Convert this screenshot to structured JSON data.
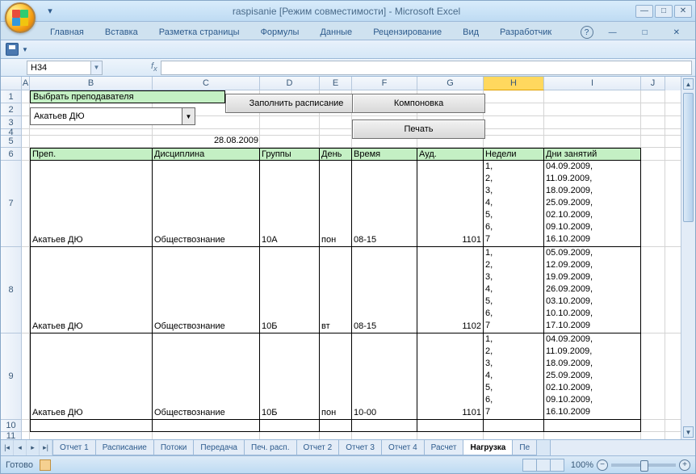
{
  "app": {
    "title": "raspisanie  [Режим совместимости] - Microsoft Excel"
  },
  "ribbon": {
    "tabs": [
      "Главная",
      "Вставка",
      "Разметка страницы",
      "Формулы",
      "Данные",
      "Рецензирование",
      "Вид",
      "Разработчик"
    ]
  },
  "namebox": "H34",
  "columns": {
    "A": 10,
    "B": 152,
    "C": 133,
    "D": 74,
    "E": 40,
    "F": 81,
    "G": 82,
    "H": 75,
    "I": 120,
    "J": 30
  },
  "row_heights": {
    "1": 16,
    "2": 16,
    "3": 16,
    "4": 8,
    "5": 15,
    "6": 16,
    "7": 107,
    "8": 107,
    "9": 107,
    "10": 15,
    "11": 11
  },
  "sheet": {
    "select_label": "Выбрать преподавателя",
    "select_value": "Акатьев ДЮ",
    "btn_fill": "Заполнить расписание",
    "btn_layout": "Компоновка",
    "btn_print": "Печать",
    "date": "28.08.2009",
    "headers": [
      "Преп.",
      "Дисциплина",
      "Группы",
      "День",
      "Время",
      "Ауд.",
      "Недели",
      "Дни занятий"
    ],
    "rows": [
      {
        "prep": "Акатьев ДЮ",
        "disc": "Обществознание",
        "grp": "10А",
        "day": "пон",
        "time": "08-15",
        "aud": "1101",
        "weeks": "1,\n2,\n3,\n4,\n5,\n6,\n7",
        "dates": "04.09.2009,\n11.09.2009,\n18.09.2009,\n25.09.2009,\n02.10.2009,\n09.10.2009,\n16.10.2009"
      },
      {
        "prep": "Акатьев ДЮ",
        "disc": "Обществознание",
        "grp": "10Б",
        "day": "вт",
        "time": "08-15",
        "aud": "1102",
        "weeks": "1,\n2,\n3,\n4,\n5,\n6,\n7",
        "dates": "05.09.2009,\n12.09.2009,\n19.09.2009,\n26.09.2009,\n03.10.2009,\n10.10.2009,\n17.10.2009"
      },
      {
        "prep": "Акатьев ДЮ",
        "disc": "Обществознание",
        "grp": "10Б",
        "day": "пон",
        "time": "10-00",
        "aud": "1101",
        "weeks": "1,\n2,\n3,\n4,\n5,\n6,\n7",
        "dates": "04.09.2009,\n11.09.2009,\n18.09.2009,\n25.09.2009,\n02.10.2009,\n09.10.2009,\n16.10.2009"
      }
    ]
  },
  "sheet_tabs": [
    "Отчет 1",
    "Расписание",
    "Потоки",
    "Передача",
    "Печ. расп.",
    "Отчет 2",
    "Отчет 3",
    "Отчет 4",
    "Расчет",
    "Нагрузка",
    "Пе"
  ],
  "active_tab": "Нагрузка",
  "status": {
    "ready": "Готово",
    "zoom": "100%"
  }
}
